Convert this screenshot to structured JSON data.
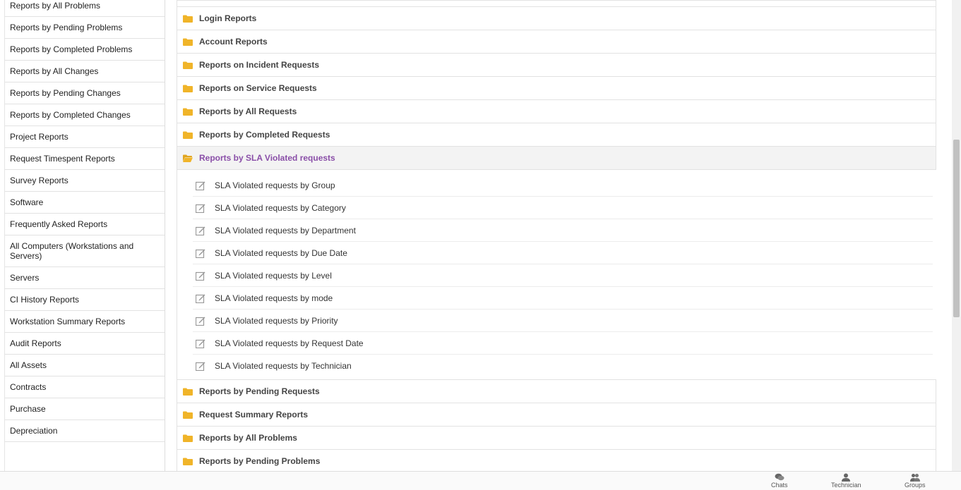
{
  "sidebar": {
    "items": [
      {
        "label": "Reports by All Problems"
      },
      {
        "label": "Reports by Pending Problems"
      },
      {
        "label": "Reports by Completed Problems"
      },
      {
        "label": "Reports by All Changes"
      },
      {
        "label": "Reports by Pending Changes"
      },
      {
        "label": "Reports by Completed Changes"
      },
      {
        "label": "Project Reports"
      },
      {
        "label": "Request Timespent Reports"
      },
      {
        "label": "Survey Reports"
      },
      {
        "label": "Software"
      },
      {
        "label": "Frequently Asked Reports"
      },
      {
        "label": "All Computers (Workstations and Servers)"
      },
      {
        "label": "Servers"
      },
      {
        "label": "CI History Reports"
      },
      {
        "label": "Workstation Summary Reports"
      },
      {
        "label": "Audit Reports"
      },
      {
        "label": "All Assets"
      },
      {
        "label": "Contracts"
      },
      {
        "label": "Purchase"
      },
      {
        "label": "Depreciation"
      }
    ]
  },
  "main": {
    "categories_before": [
      {
        "label": "Login Reports"
      },
      {
        "label": "Account Reports"
      },
      {
        "label": "Reports on Incident Requests"
      },
      {
        "label": "Reports on Service Requests"
      },
      {
        "label": "Reports by All Requests"
      },
      {
        "label": "Reports by Completed Requests"
      }
    ],
    "active_category": {
      "label": "Reports by SLA Violated requests"
    },
    "sub_reports": [
      {
        "label": "SLA Violated requests by Group"
      },
      {
        "label": "SLA Violated requests by Category"
      },
      {
        "label": "SLA Violated requests by Department"
      },
      {
        "label": "SLA Violated requests by Due Date"
      },
      {
        "label": "SLA Violated requests by Level"
      },
      {
        "label": "SLA Violated requests by mode"
      },
      {
        "label": "SLA Violated requests by Priority"
      },
      {
        "label": "SLA Violated requests by Request Date"
      },
      {
        "label": "SLA Violated requests by Technician"
      }
    ],
    "categories_after": [
      {
        "label": "Reports by Pending Requests"
      },
      {
        "label": "Request Summary Reports"
      },
      {
        "label": "Reports by All Problems"
      },
      {
        "label": "Reports by Pending Problems"
      }
    ]
  },
  "bottom_bar": {
    "chats_label": "Chats",
    "technician_label": "Technician",
    "groups_label": "Groups"
  },
  "colors": {
    "folder": "#f0b429",
    "active_text": "#8a4fa8",
    "edit_icon": "#999999"
  }
}
